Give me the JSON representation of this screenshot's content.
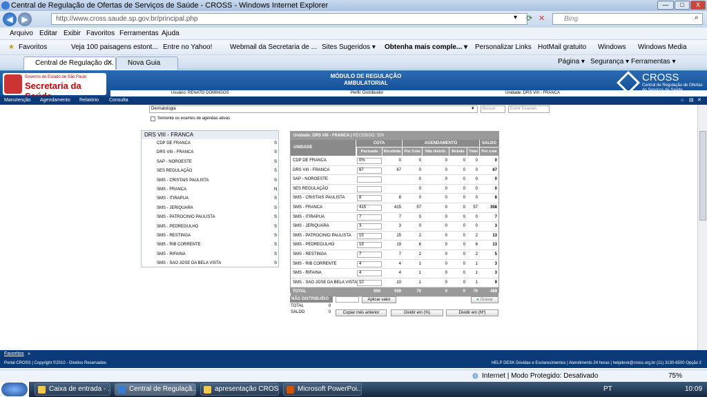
{
  "window": {
    "title": "Central de Regulação de Ofertas de Serviços de Saúde - CROSS - Windows Internet Explorer",
    "minimize": "—",
    "maximize": "□",
    "close": "X"
  },
  "address": {
    "url": "http://www.cross.saude.sp.gov.br/principal.php",
    "search_placeholder": "Bing"
  },
  "menu": [
    "Arquivo",
    "Editar",
    "Exibir",
    "Favoritos",
    "Ferramentas",
    "Ajuda"
  ],
  "favbar": [
    "Favoritos",
    "Veja 100 paisagens estont...",
    "Entre no Yahoo!",
    "Webmail da Secretaria de ...",
    "Sites Sugeridos ▾",
    "Obtenha mais comple... ▾",
    "Personalizar Links",
    "HotMail gratuito",
    "Windows",
    "Windows Media"
  ],
  "tabs": [
    "Central de Regulação d...",
    "Nova Guia"
  ],
  "tools": [
    "Página ▾",
    "Segurança ▾",
    "Ferramentas ▾"
  ],
  "banner": {
    "gov": "Governo do Estado de São Paulo",
    "sec": "Secretaria da Saúde",
    "module": "MÓDULO DE REGULAÇÃO AMBULATORIAL",
    "cross": "CROSS",
    "cross_sub": "Central de Regulação de Ofertas de Serviços de Saúde",
    "user": "Usuário: RENATO DOMINGOS",
    "profile": "Perfil: Distribuidor",
    "unit": "Unidade: DRS VIII - FRANCA"
  },
  "nav": [
    "Manutenção",
    "Agendamento",
    "Relatório",
    "Consulta"
  ],
  "filters": {
    "specialty": "Dermatologia",
    "buscar": "Buscar",
    "exibir": "Exibir Exames",
    "checkbox": "Somente os exames de agendas ativas"
  },
  "tree": {
    "title": "DRS VIII - FRANCA",
    "items": [
      [
        "CDP DE FRANCA",
        "S"
      ],
      [
        "DRS VIII - FRANCA",
        "S"
      ],
      [
        "SAP - NOROESTE",
        "S"
      ],
      [
        "SES REGULAÇÃO",
        "S"
      ],
      [
        "SMS - CRISTAIS PAULISTA",
        "S"
      ],
      [
        "SMS - FRANCA",
        "N"
      ],
      [
        "SMS - ITIRAPUA",
        "S"
      ],
      [
        "SMS - JERIQUARA",
        "S"
      ],
      [
        "SMS - PATROCINIO PAULISTA",
        "S"
      ],
      [
        "SMS - PEDREGULHO",
        "S"
      ],
      [
        "SMS - RESTINGA",
        "S"
      ],
      [
        "SMS - RIB CORRENTE",
        "S"
      ],
      [
        "SMS - RIFAINA",
        "S"
      ],
      [
        "SMS - SAO JOSE DA BELA VISTA",
        "S"
      ]
    ]
  },
  "grid": {
    "unit_label": "Unidade: DRS VIII - FRANCA",
    "recebido": "RECEBIDO: 559",
    "h_unidade": "UNIDADE",
    "h_cota": "COTA",
    "h_agend": "AGENDAMENTO",
    "h_saldo": "SALDO",
    "sub": [
      "Pactuada",
      "Recebida",
      "Por Cota",
      "Não distrib.",
      "Bolsão",
      "Total",
      "Por cota"
    ],
    "rows": [
      [
        "CDP DE FRANCA",
        "0%",
        "0",
        "0",
        "0",
        "0",
        "0",
        "0"
      ],
      [
        "DRS VIII - FRANCA",
        "67",
        "67",
        "0",
        "0",
        "0",
        "0",
        "67"
      ],
      [
        "SAP - NOROESTE",
        "",
        "",
        "0",
        "0",
        "0",
        "0",
        "0"
      ],
      [
        "SES REGULAÇÃO",
        "",
        "",
        "0",
        "0",
        "0",
        "0",
        "0"
      ],
      [
        "SMS - CRISTAIS PAULISTA",
        "8",
        "8",
        "0",
        "0",
        "0",
        "0",
        "8"
      ],
      [
        "SMS - FRANCA",
        "415",
        "415",
        "57",
        "0",
        "0",
        "57",
        "358"
      ],
      [
        "SMS - ITIRAPUA",
        "7",
        "7",
        "0",
        "0",
        "0",
        "0",
        "7"
      ],
      [
        "SMS - JERIQUARA",
        "3",
        "3",
        "0",
        "0",
        "0",
        "0",
        "3"
      ],
      [
        "SMS - PATROCINIO PAULISTA",
        "15",
        "15",
        "2",
        "0",
        "0",
        "2",
        "13"
      ],
      [
        "SMS - PEDREGULHO",
        "19",
        "19",
        "6",
        "0",
        "0",
        "6",
        "13"
      ],
      [
        "SMS - RESTINGA",
        "7",
        "7",
        "2",
        "0",
        "0",
        "2",
        "5"
      ],
      [
        "SMS - RIB CORRENTE",
        "4",
        "4",
        "1",
        "0",
        "0",
        "1",
        "3"
      ],
      [
        "SMS - RIFAINA",
        "4",
        "4",
        "1",
        "0",
        "0",
        "1",
        "3"
      ],
      [
        "SMS - SAO JOSE DA BELA VISTA",
        "10",
        "10",
        "1",
        "0",
        "0",
        "1",
        "9"
      ]
    ],
    "total": [
      "TOTAL",
      "559",
      "559",
      "70",
      "0",
      "0",
      "70",
      "489"
    ]
  },
  "bottom": {
    "nd": "NÃO DISTRIBUÍDO",
    "total": "TOTAL",
    "saldo": "SALDO",
    "zero1": "0",
    "zero2": "0",
    "aplicar": "Aplicar valor",
    "gravar": "Gravar",
    "copiar": "Copiar mês anterior",
    "dividir_pct": "Dividir em (%)",
    "dividir_n": "Dividir em (Nº)"
  },
  "favoritos": "Favoritos",
  "footer": {
    "left": "Portal CROSS | Copyright ©2010 - Direitos Reservados",
    "right": "HELP DESK  Dúvidas e Esclarecimentos | Atendimento 24 horas | helpdesk@cross.org.br (11) 3130-6500 Opção 2"
  },
  "status": {
    "zone": "Internet | Modo Protegido: Desativado",
    "zoom": "75%"
  },
  "taskbar": {
    "items": [
      "Caixa de entrada - ...",
      "Central de Regulaçã...",
      "apresentação CROSS",
      "Microsoft PowerPoi..."
    ],
    "clock": "10:09",
    "lang": "PT"
  }
}
